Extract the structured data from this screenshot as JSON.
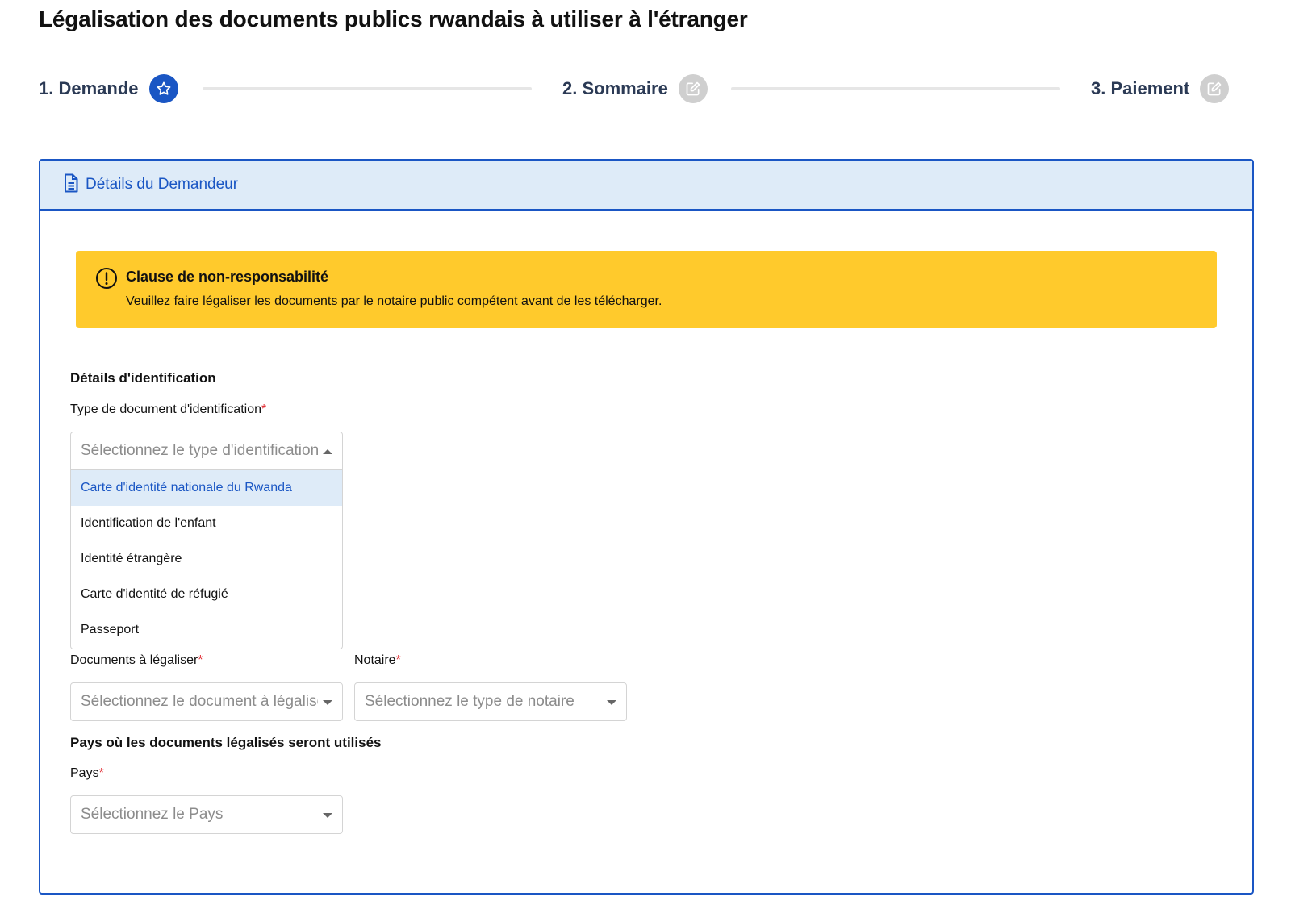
{
  "page": {
    "title": "Légalisation des documents publics rwandais à utiliser à l'étranger"
  },
  "stepper": {
    "steps": [
      {
        "label": "1. Demande",
        "icon": "star-icon",
        "state": "active"
      },
      {
        "label": "2. Sommaire",
        "icon": "edit-icon",
        "state": "inactive"
      },
      {
        "label": "3. Paiement",
        "icon": "edit-icon",
        "state": "inactive"
      }
    ]
  },
  "card": {
    "header_icon": "document-icon",
    "header_title": "Détails du Demandeur"
  },
  "alert": {
    "icon": "exclamation-circle-icon",
    "title": "Clause de non-responsabilité",
    "text": "Veuillez faire légaliser les documents par le notaire public compétent avant de les télécharger."
  },
  "identification": {
    "section_title": "Détails d'identification",
    "id_type": {
      "label": "Type de document d'identification",
      "required_mark": "*",
      "placeholder": "Sélectionnez le type d'identification",
      "expanded": true,
      "options": [
        "Carte d'identité nationale du Rwanda",
        "Identification de l'enfant",
        "Identité étrangère",
        "Carte d'identité de réfugié",
        "Passeport"
      ],
      "highlighted_option": "Carte d'identité nationale du Rwanda"
    },
    "documents": {
      "label": "Documents à légaliser",
      "required_mark": "*",
      "placeholder": "Sélectionnez le document à légaliser"
    },
    "notary": {
      "label": "Notaire",
      "required_mark": "*",
      "placeholder": "Sélectionnez le type de notaire"
    }
  },
  "country": {
    "section_title": "Pays où les documents légalisés seront utilisés",
    "label": "Pays",
    "required_mark": "*",
    "placeholder": "Sélectionnez le Pays"
  },
  "colors": {
    "primary": "#1a56c4",
    "header_bg": "#deebf8",
    "alert_bg": "#ffca2c",
    "required": "#e0242b",
    "inactive_step": "#cfcfcf"
  }
}
